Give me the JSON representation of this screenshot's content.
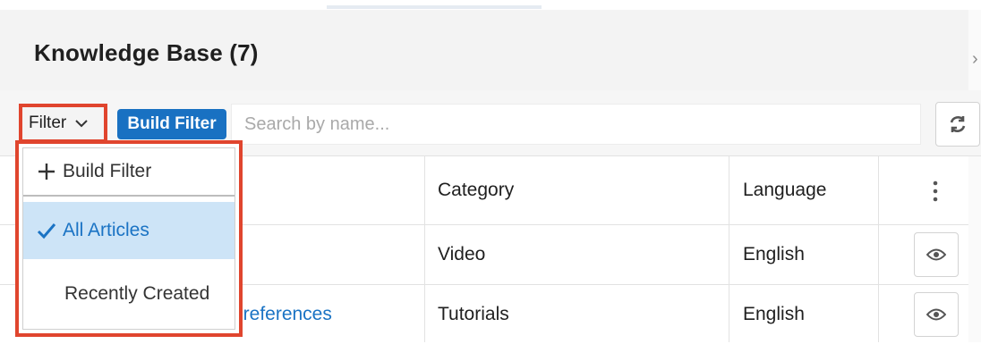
{
  "panel": {
    "title": "Knowledge Base (7)"
  },
  "filter_bar": {
    "filter_label": "Filter",
    "build_filter_label": "Build Filter",
    "search_placeholder": "Search by name..."
  },
  "table": {
    "columns": [
      "Category",
      "Language"
    ],
    "rows": [
      {
        "name": "",
        "category": "Video",
        "language": "English"
      },
      {
        "name": "How to update your email preferences",
        "category": "Tutorials",
        "language": "English"
      }
    ]
  },
  "filter_menu": {
    "items": [
      {
        "label": "Build Filter",
        "icon": "plus-icon",
        "selected": false
      },
      {
        "label": "All Articles",
        "icon": "checkmark-icon",
        "selected": true
      },
      {
        "label": "Recently Created",
        "icon": "",
        "selected": false
      }
    ]
  },
  "colors": {
    "accent_blue": "#1971c2",
    "link_blue": "#1a73c4",
    "highlight_red": "#e0452e",
    "selected_bg": "#cde4f7"
  }
}
